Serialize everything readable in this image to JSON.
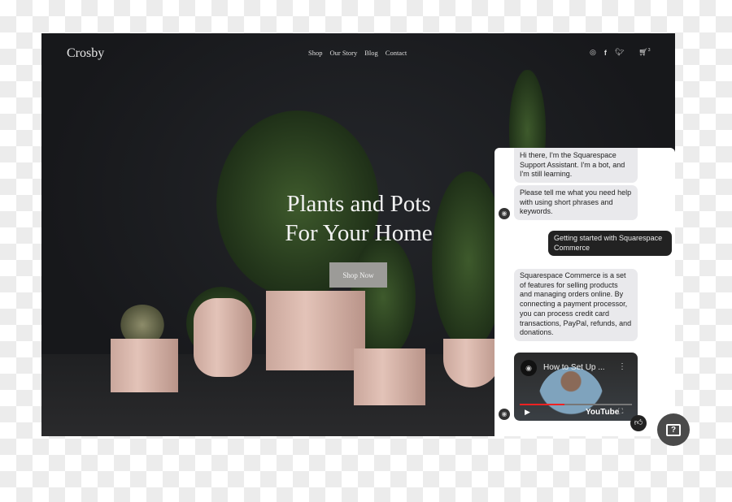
{
  "site": {
    "logo": "Crosby",
    "nav": [
      "Shop",
      "Our Story",
      "Blog",
      "Contact"
    ],
    "cart_count": "3",
    "social_icons": [
      "instagram-icon",
      "facebook-icon",
      "twitter-icon",
      "cart-icon"
    ]
  },
  "hero": {
    "title_line1": "Plants and Pots",
    "title_line2": "For Your Home",
    "cta": "Shop Now"
  },
  "chat": {
    "messages": [
      {
        "from": "bot",
        "text": "Hi there, I'm the Squarespace Support Assistant. I'm a bot, and I'm still learning."
      },
      {
        "from": "bot",
        "text": "Please tell me what you need help with using short phrases and keywords."
      },
      {
        "from": "user",
        "text": "Getting started with Squarespace Commerce"
      },
      {
        "from": "bot",
        "text": "Squarespace Commerce is a set of features for selling products and managing orders online. By connecting a payment processor, you can process credit card transactions, PayPal, refunds, and donations."
      }
    ],
    "video": {
      "title": "How to Set Up ...",
      "brand": "YouTube",
      "progress": 0.4
    }
  },
  "colors": {
    "user_bubble": "#222222",
    "bot_bubble": "#e9e9ec",
    "youtube_progress": "#e22222"
  }
}
